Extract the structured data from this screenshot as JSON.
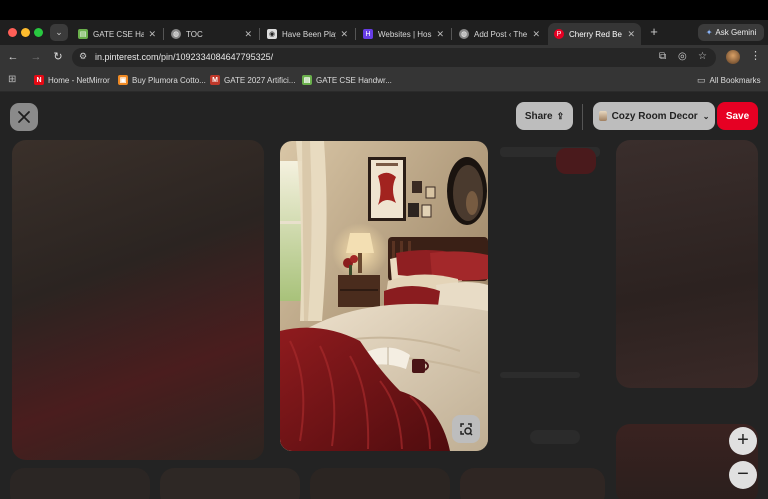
{
  "browser": {
    "tabs": [
      {
        "title": "GATE CSE Hand",
        "favicon": "gate-icon",
        "active": false
      },
      {
        "title": "TOC",
        "favicon": "globe-icon",
        "active": false
      },
      {
        "title": "Have Been Play",
        "favicon": "app-icon",
        "active": false
      },
      {
        "title": "Websites | Hos",
        "favicon": "hostinger-icon",
        "active": false
      },
      {
        "title": "Add Post ‹ The",
        "favicon": "wordpress-icon",
        "active": false
      },
      {
        "title": "Cherry Red Be",
        "favicon": "pinterest-icon",
        "active": true
      }
    ],
    "gemini_label": "Ask Gemini",
    "url": "in.pinterest.com/pin/1092334084647795325/",
    "bookmarks": [
      {
        "label": "Home - NetMirror",
        "favicon": "netmirror-icon",
        "color": "#e50914"
      },
      {
        "label": "Buy Plumora Cotto...",
        "favicon": "shop-icon",
        "color": "#f08a24"
      },
      {
        "label": "GATE 2027 Artifici...",
        "favicon": "m-icon",
        "color": "#c0392b"
      },
      {
        "label": "GATE CSE Handwr...",
        "favicon": "gate-icon",
        "color": "#6ab04c"
      }
    ],
    "all_bookmarks": "All Bookmarks"
  },
  "pin_view": {
    "share_label": "Share",
    "board_label": "Cozy Room Decor",
    "save_label": "Save",
    "zoom_in": "+",
    "zoom_out": "−",
    "image_description": "cozy bedroom with red knit blanket",
    "accent": "#e60023"
  }
}
